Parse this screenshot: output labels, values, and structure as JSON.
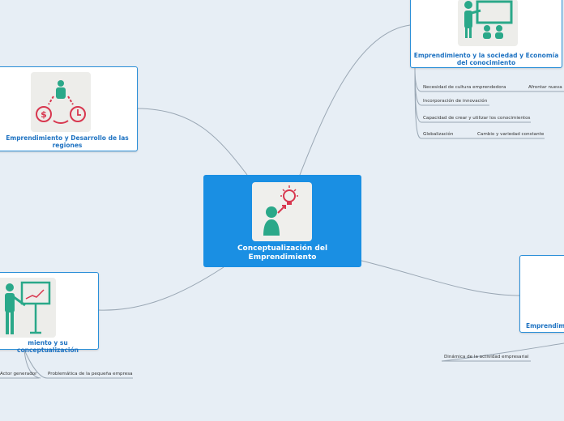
{
  "central": {
    "title_line1": "Conceptualización del",
    "title_line2": "Emprendimiento",
    "icon": "person-lightbulb-icon"
  },
  "topics": {
    "sociedad": {
      "title_line1": "Emprendimiento y la sociedad y Economía",
      "title_line2": "del conocimiento",
      "icon": "teacher-board-icon",
      "subtopics": [
        "Necesidad de cultura emprendedora",
        "Afrontar nueva",
        "Incorporación de innovación",
        "Capacidad de crear y utilizar los conocimientos",
        "Globalización",
        "Cambio y variedad constante"
      ]
    },
    "regiones": {
      "title_line1": "Emprendimiento y Desarrollo de las",
      "title_line2": "regiones",
      "icon": "money-cycle-icon"
    },
    "conceptualizacion": {
      "title": "miento y su conceptualización",
      "icon": "presenter-chart-icon",
      "subtopics": [
        "Actor generador",
        "Problemática de la pequeña empresa"
      ]
    },
    "right": {
      "title": "Emprendimi",
      "subtopics": [
        "Dinámica de la actividad empresarial"
      ]
    }
  },
  "colors": {
    "background": "#e7eef5",
    "central": "#1a8fe3",
    "border": "#2a8fd8",
    "topic_text": "#1f73c2",
    "teal": "#2aa889",
    "red": "#d8374f"
  }
}
